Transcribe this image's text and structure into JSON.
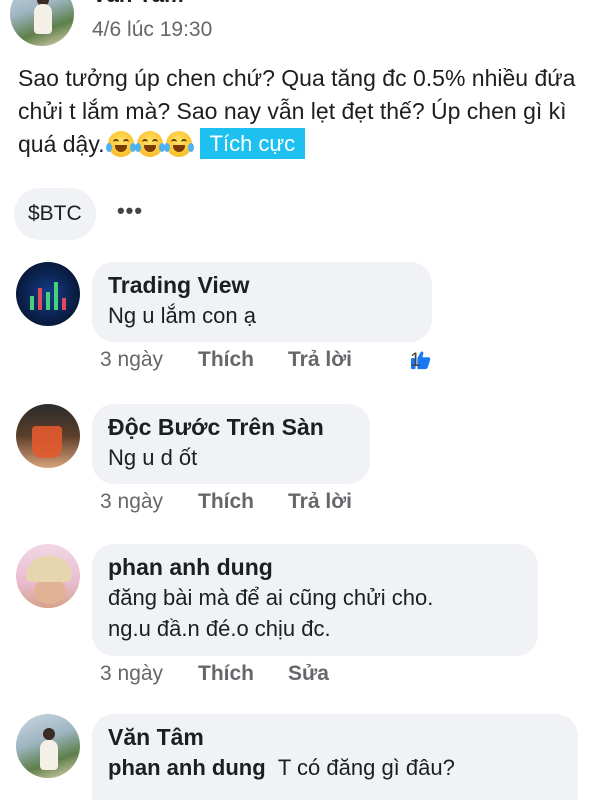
{
  "post": {
    "author": "Văn Tâm",
    "time": "4/6 lúc 19:30",
    "text": "Sao tưởng úp chen chứ? Qua tăng đc 0.5% nhiều đứa chửi t lắm mà? Sao nay vẫn lẹt đẹt thế? Úp chen gì kì quá dậy.",
    "emojis": [
      "face-with-tears-of-joy-icon",
      "face-with-tears-of-joy-icon",
      "face-with-tears-of-joy-icon"
    ],
    "sentiment_tag": "Tích cực",
    "ticker_chip": "$BTC",
    "more": "•••"
  },
  "comments": [
    {
      "name": "Trading View",
      "text": "Ng u lắm con ạ",
      "time": "3 ngày",
      "like": "Thích",
      "reply": "Trả lời",
      "like_count": "1"
    },
    {
      "name": "Độc Bước Trên Sàn",
      "text": "Ng u d ốt",
      "time": "3 ngày",
      "like": "Thích",
      "reply": "Trả lời"
    },
    {
      "name": "phan anh dung",
      "text_line1": "đăng bài mà để ai cũng chửi cho.",
      "text_line2": "ng.u đầ.n đé.o chịu đc.",
      "time": "3 ngày",
      "like": "Thích",
      "edit": "Sửa"
    },
    {
      "name": "Văn Tâm",
      "reply_to": "phan anh dung",
      "text": "T có đăng gì đâu?"
    }
  ],
  "colors": {
    "accent_blue": "#1ec0f0",
    "bubble_bg": "#f0f2f5",
    "secondary_text": "#65676b",
    "like_blue": "#1877f2"
  }
}
